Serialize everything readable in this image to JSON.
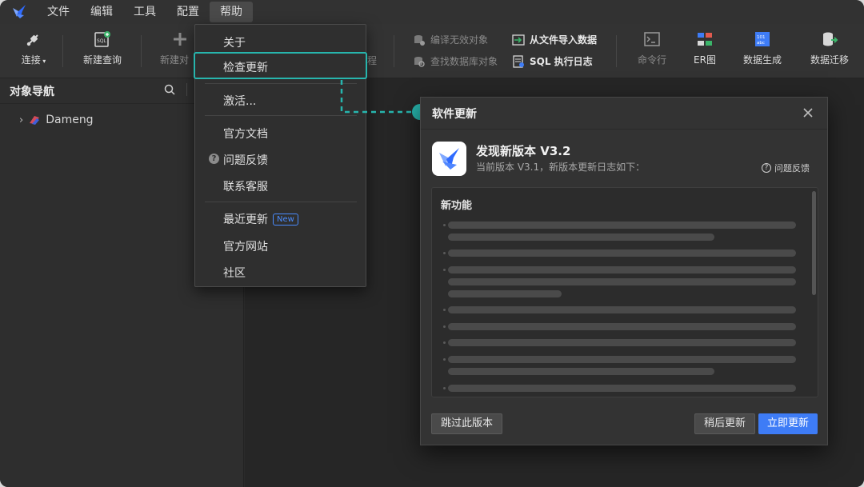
{
  "menubar": {
    "items": [
      "文件",
      "编辑",
      "工具",
      "配置",
      "帮助"
    ]
  },
  "toolbar": {
    "connect": "连接",
    "new_query": "新建查询",
    "new_object": "新建对",
    "procedure_tail": "程",
    "compile_invalid": "编译无效对象",
    "find_db_object": "查找数据库对象",
    "import_data": "从文件导入数据",
    "sql_log": "SQL 执行日志",
    "command_line": "命令行",
    "er_diagram": "ER图",
    "data_generate": "数据生成",
    "data_migrate": "数据迁移"
  },
  "nav": {
    "title": "对象导航",
    "tree_item": "Dameng"
  },
  "help_menu": {
    "about": "关于",
    "check_update": "检查更新",
    "activate": "激活...",
    "official_docs": "官方文档",
    "feedback": "问题反馈",
    "contact_support": "联系客服",
    "recent_updates": "最近更新",
    "new_badge": "New",
    "official_site": "官方网站",
    "community": "社区"
  },
  "dialog": {
    "title": "软件更新",
    "heading": "发现新版本 V3.2",
    "subtitle": "当前版本 V3.1，新版本更新日志如下：",
    "feedback": "问题反馈",
    "log_title": "新功能",
    "skip": "跳过此版本",
    "later": "稍后更新",
    "update_now": "立即更新"
  },
  "colors": {
    "accent_teal": "#27b5ad",
    "primary_blue": "#3e7cf6",
    "logo_blue": "#2f6bff"
  }
}
